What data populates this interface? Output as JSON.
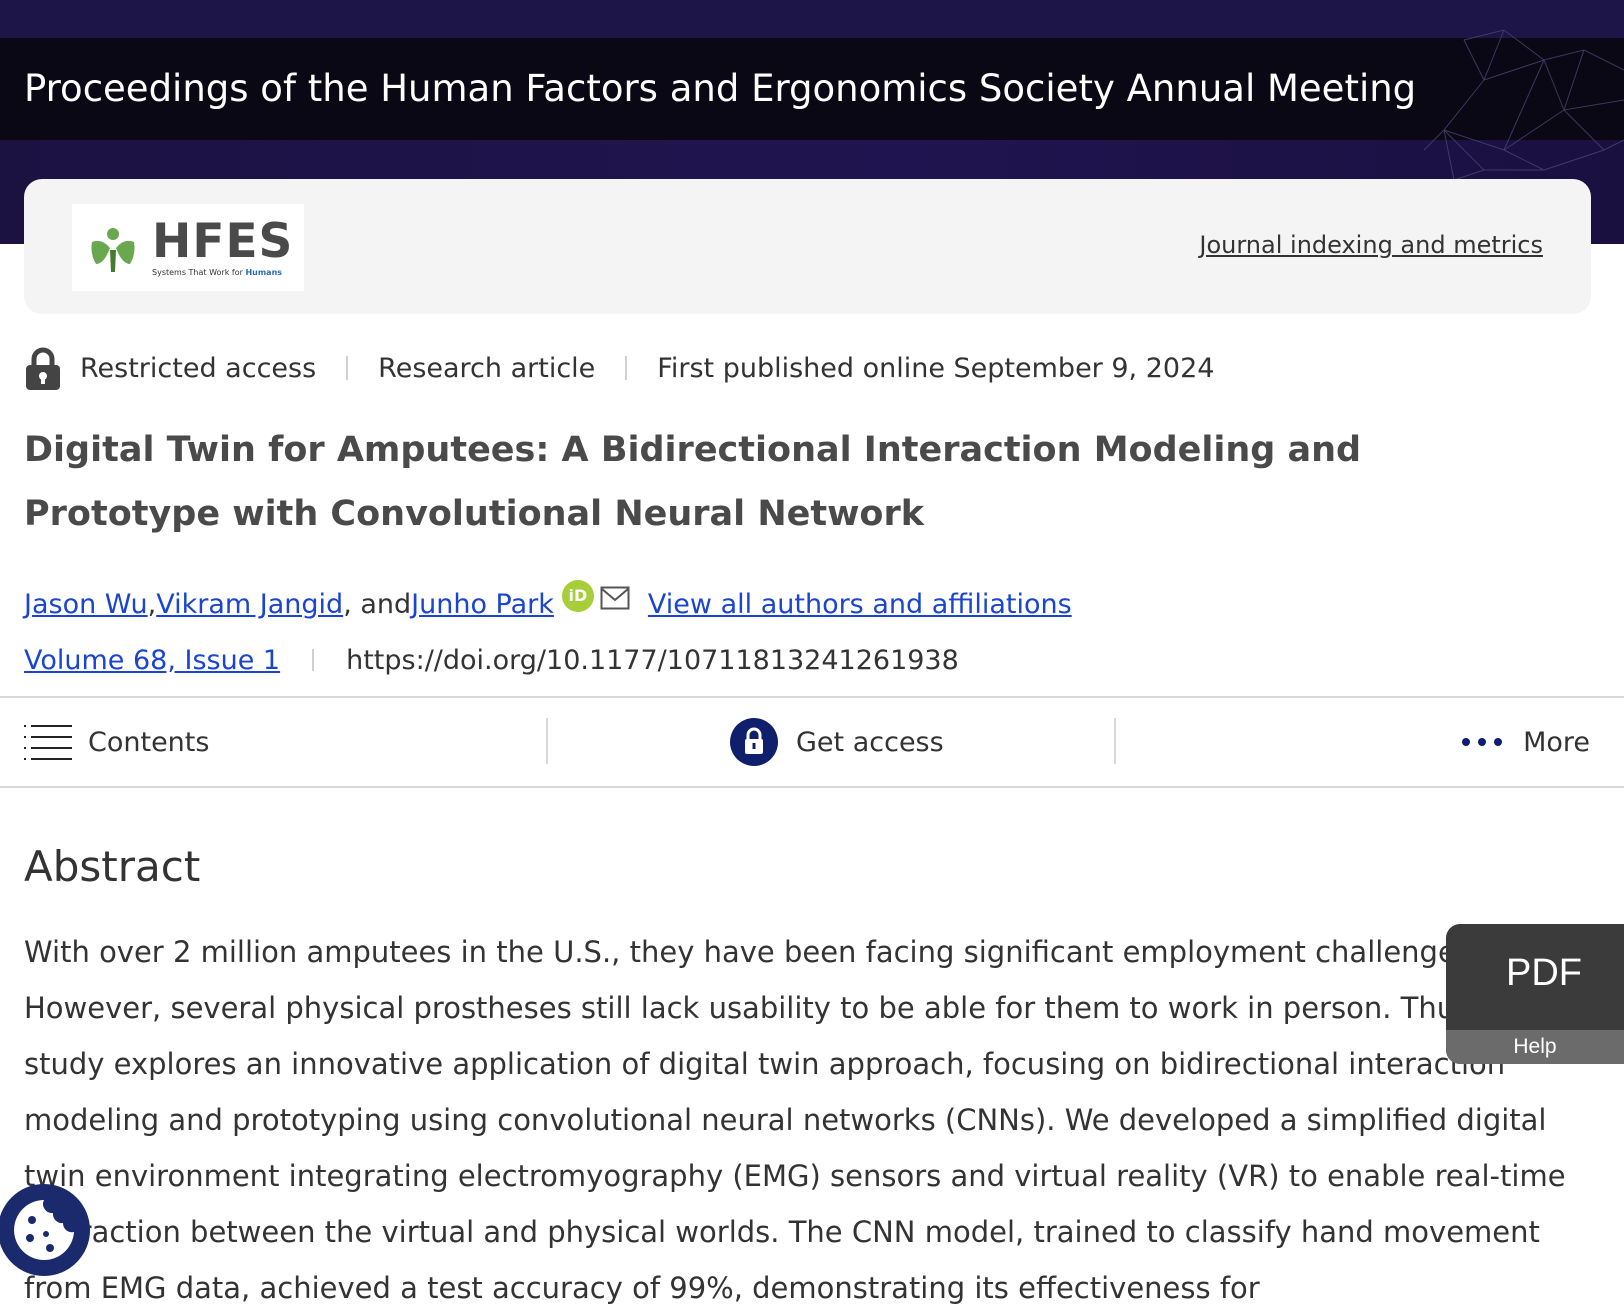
{
  "banner": {
    "journal_title": "Proceedings of the Human Factors and Ergonomics Society Annual Meeting"
  },
  "brand": {
    "logo_text": "HFES",
    "logo_tagline_prefix": "Systems That Work for",
    "logo_tagline_highlight": "Humans",
    "indexing_link": "Journal indexing and metrics"
  },
  "meta": {
    "access": "Restricted access",
    "type": "Research article",
    "published": "First published online September 9, 2024"
  },
  "article": {
    "title": "Digital Twin for Amputees: A Bidirectional Interaction Modeling and Prototype with Convolutional Neural Network"
  },
  "authors": {
    "list": [
      "Jason Wu",
      "Vikram Jangid",
      "Junho Park"
    ],
    "separator": ", ",
    "conjunction": ", and ",
    "orcid_label": "iD",
    "view_all": "View all authors and affiliations"
  },
  "issue": {
    "volume": "Volume 68, Issue 1",
    "doi": "https://doi.org/10.1177/10711813241261938"
  },
  "toolbar": {
    "contents": "Contents",
    "get_access": "Get access",
    "more": "More"
  },
  "abstract": {
    "heading": "Abstract",
    "text": "With over 2 million amputees in the U.S., they have been facing significant employment challenges. However, several physical prostheses still lack usability to be able for them to work in person. Thus, this study explores an innovative application of digital twin approach, focusing on bidirectional interaction modeling and prototyping using convolutional neural networks (CNNs). We developed a simplified digital twin environment integrating electromyography (EMG) sensors and virtual reality (VR) to enable real-time interaction between the virtual and physical worlds. The CNN model, trained to classify hand movement from EMG data, achieved a test accuracy of 99%, demonstrating its effectiveness for"
  },
  "pdf_widget": {
    "label": "PDF",
    "help": "Help"
  },
  "icons": {
    "lock": "lock-icon",
    "orcid": "orcid-icon",
    "mail": "mail-icon",
    "contents": "list-icon",
    "access": "lock-circle-icon",
    "more": "more-dots-icon",
    "cookie": "cookie-icon"
  },
  "colors": {
    "banner": "#1d1447",
    "title_bar": "#0a0814",
    "link": "#1a44d1",
    "orcid": "#a6ce39",
    "access_icon": "#0f1f6b",
    "pdf_widget": "#3b3b3b"
  }
}
